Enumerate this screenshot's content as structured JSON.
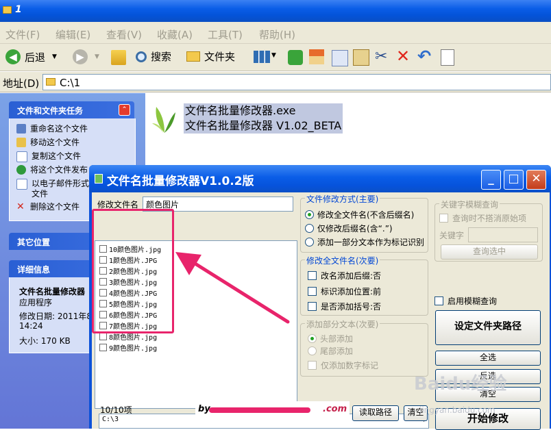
{
  "explorer": {
    "title": "1",
    "menu": [
      "文件(F)",
      "编辑(E)",
      "查看(V)",
      "收藏(A)",
      "工具(T)",
      "帮助(H)"
    ],
    "toolbar": {
      "back": "后退",
      "search": "搜索",
      "folders": "文件夹"
    },
    "address": {
      "label": "地址(D)",
      "path": "C:\\1"
    },
    "tasks": {
      "title": "文件和文件夹任务",
      "items": [
        "重命名这个文件",
        "移动这个文件",
        "复制这个文件",
        "将这个文件发布",
        "以电子邮件形式",
        "文件",
        "删除这个文件"
      ]
    },
    "other_places": {
      "title": "其它位置"
    },
    "details": {
      "title": "详细信息",
      "name": "文件名批量修改器",
      "type": "应用程序",
      "modified": "修改日期: 2011年8",
      "time": "14:24",
      "size": "大小: 170 KB"
    },
    "file": {
      "line1": "文件名批量修改器.exe",
      "line2": "文件名批量修改器 V1.02_BETA"
    }
  },
  "app": {
    "title": "文件名批量修改器V1.0.2版",
    "rename_label": "修改文件名",
    "rename_value": "颜色图片",
    "files": [
      "10颜色图片.jpg",
      "1颜色图片.JPG",
      "2颜色图片.jpg",
      "3颜色图片.jpg",
      "4颜色图片.JPG",
      "5颜色图片.jpg",
      "6颜色图片.JPG",
      "7颜色图片.jpg",
      "8颜色图片.jpg",
      "9颜色图片.jpg"
    ],
    "mode_group": {
      "title": "文件修改方式(主要)",
      "options": [
        "修改全文件名(不含后缀名)",
        "仅修改后缀名(含“.”)",
        "添加一部分文本作为标记识别"
      ]
    },
    "full_group": {
      "title": "修改全文件名(次要)",
      "options": [
        "改名添加后缀:否",
        "标识添加位置:前",
        "是否添加括号:否"
      ]
    },
    "partial_group": {
      "title": "添加部分文本(次要)",
      "options": [
        "头部添加",
        "尾部添加",
        "仅添加数字标记"
      ]
    },
    "keyword_group": {
      "title": "关键字模糊查询",
      "match_label": "查询时不搭消原始项",
      "keyword_label": "关键字",
      "query_btn": "查询选中"
    },
    "fuzzy_label": "启用模糊查询",
    "set_path_btn": "设定文件夹路径",
    "select_all": "全选",
    "invert": "反选",
    "clear": "清空",
    "start": "开始修改",
    "path_value": "C:\\3",
    "count": "10/10项",
    "read_path": "读取路径",
    "clear2": "清空",
    "by_prefix": "by",
    "by_suffix": ".com"
  },
  "watermark": {
    "main": "Baidu经验",
    "sub": "jingyan.baidu.com"
  }
}
